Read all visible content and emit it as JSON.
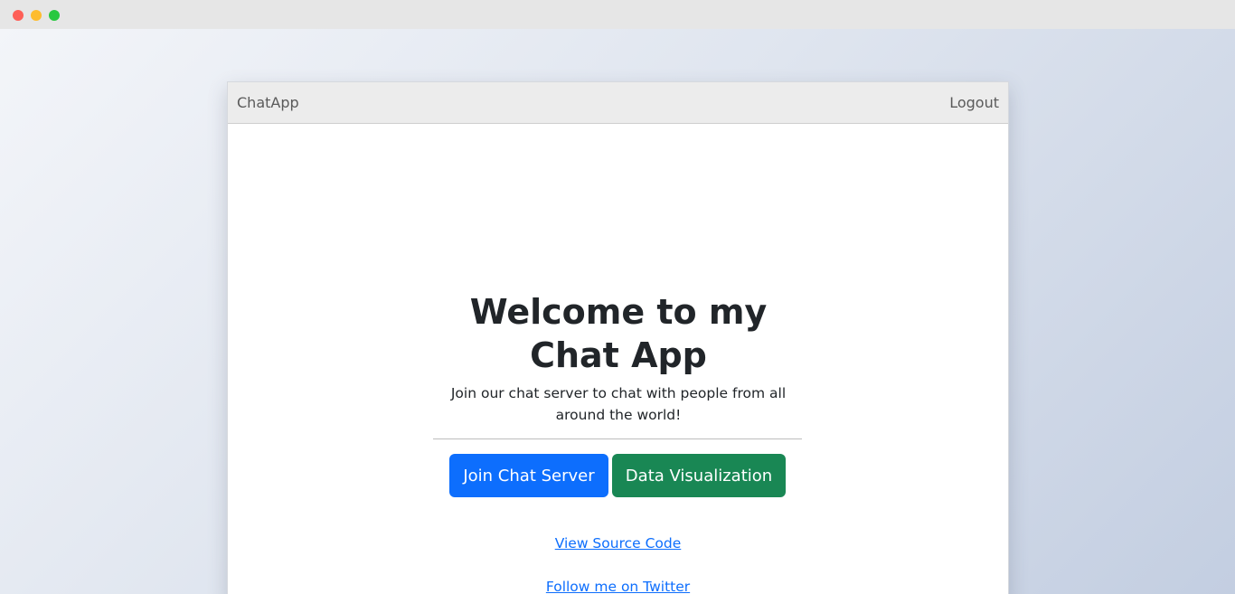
{
  "navbar": {
    "brand": "ChatApp",
    "logout": "Logout"
  },
  "hero": {
    "title": "Welcome to my Chat App",
    "subtitle": "Join our chat server to chat with people from all around the world!",
    "join_button": "Join Chat Server",
    "data_button": "Data Visualization",
    "source_link": "View Source Code",
    "twitter_link": "Follow me on Twitter"
  },
  "colors": {
    "primary": "#0d6efd",
    "success": "#198754",
    "navbar_bg": "#ececec"
  }
}
